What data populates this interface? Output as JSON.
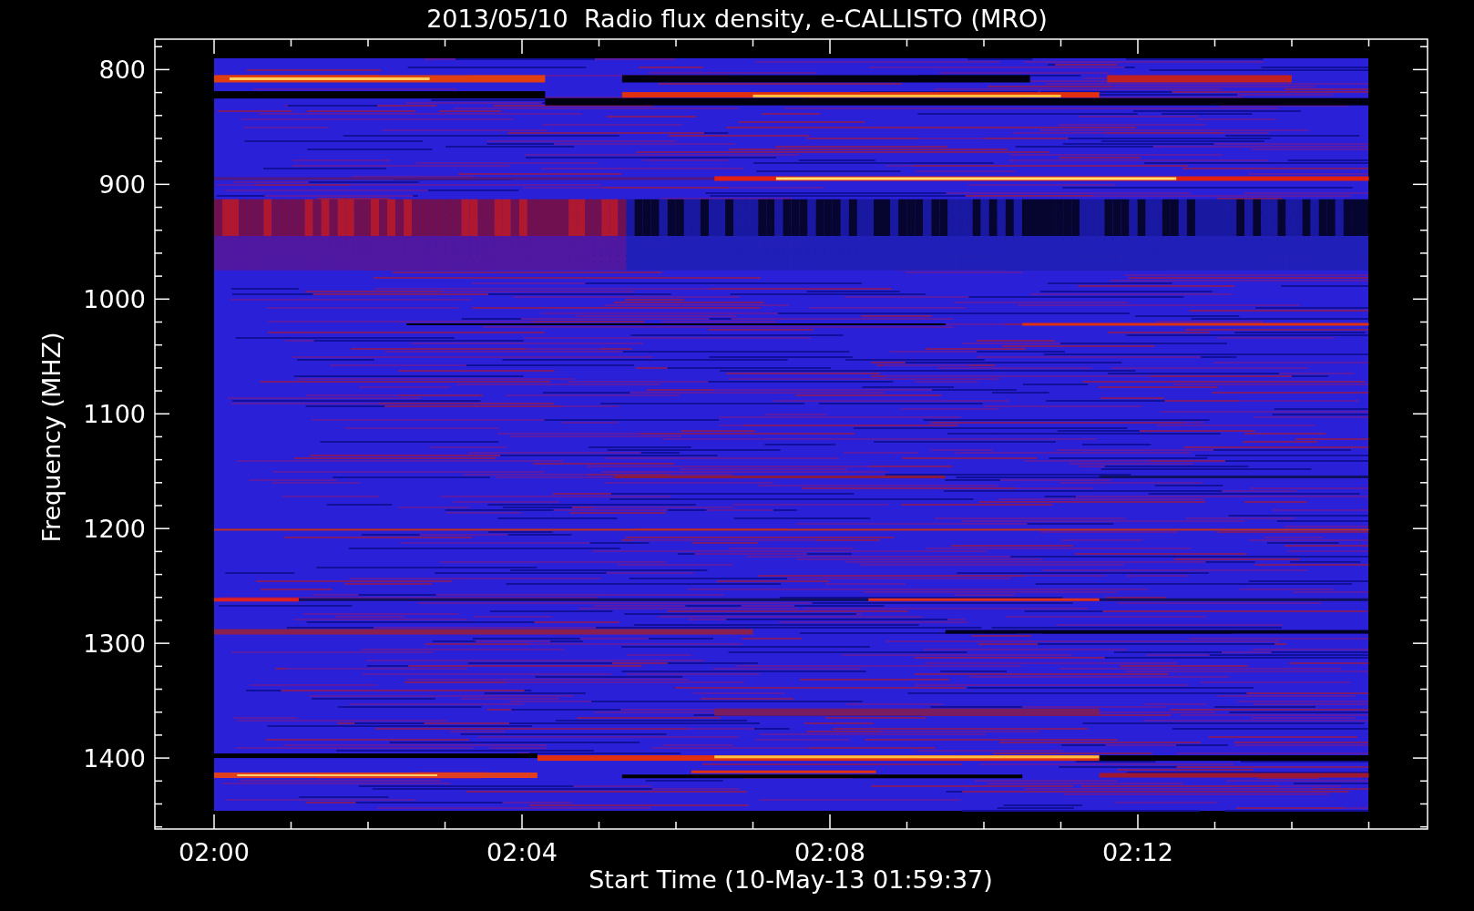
{
  "title": "2013/05/10  Radio flux density, e-CALLISTO (MRO)",
  "y_axis": {
    "label": "Frequency (MHZ)",
    "ticks": [
      "800",
      "900",
      "1000",
      "1100",
      "1200",
      "1300",
      "1400"
    ]
  },
  "x_axis": {
    "label": "Start Time (10-May-13 01:59:37)",
    "ticks": [
      "02:00",
      "02:04",
      "02:08",
      "02:12"
    ]
  }
}
